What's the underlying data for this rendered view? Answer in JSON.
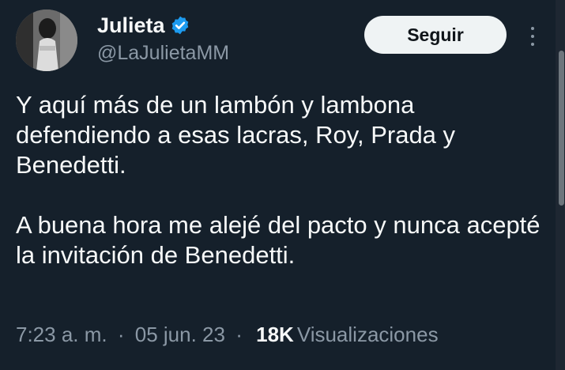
{
  "author": {
    "display_name": "Julieta",
    "handle": "@LaJulietaMM",
    "verified_icon": "verified-badge-icon",
    "verified_color": "#1d9bf0"
  },
  "follow_button": {
    "label": "Seguir"
  },
  "more_button": {
    "icon": "more-vertical-icon"
  },
  "tweet": {
    "paragraphs": [
      "Y aquí más de un lambón y lambona defendiendo a esas lacras, Roy, Prada y Benedetti.",
      "A buena hora me alejé del pacto y nunca acepté la invitación de Benedetti."
    ]
  },
  "meta": {
    "time": "7:23 a. m.",
    "separator": "·",
    "date": "05 jun. 23",
    "views_count": "18K",
    "views_label": "Visualizaciones"
  },
  "colors": {
    "background": "#15202b",
    "primary_text": "#f7f9f9",
    "secondary_text": "#8b98a5",
    "button_background": "#eff3f4",
    "button_text": "#0f1419"
  }
}
